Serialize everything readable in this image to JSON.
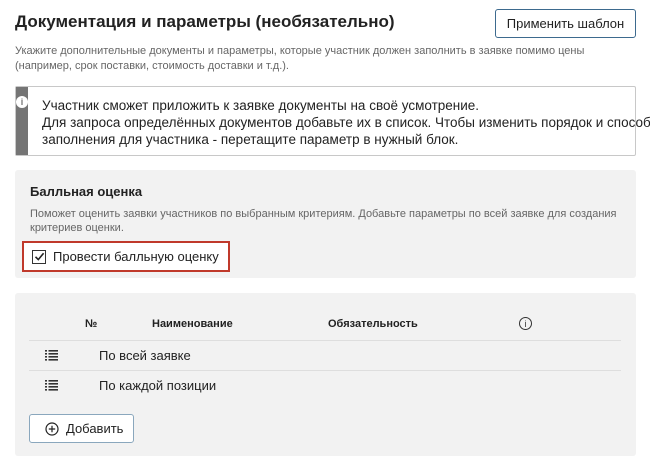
{
  "header": {
    "title": "Документация и параметры (необязательно)",
    "apply_template_label": "Применить шаблон",
    "subtitle": "Укажите дополнительные документы и параметры, которые участник должен заполнить в заявке помимо цены (например, срок поставки, стоимость доставки и т.д.)."
  },
  "info": {
    "lines": [
      "Участник сможет приложить к заявке документы на своё усмотрение.",
      "Для запроса определённых документов добавьте их в список. Чтобы изменить порядок и способ",
      "заполнения для участника - перетащите параметр в нужный блок."
    ]
  },
  "scoring": {
    "title": "Балльная оценка",
    "description": "Поможет оценить заявки участников по выбранным критериям. Добавьте параметры по всей заявке для создания критериев оценки.",
    "checkbox_label": "Провести балльную оценку",
    "checked": true
  },
  "table": {
    "columns": [
      "№",
      "Наименование",
      "Обязательность"
    ],
    "rows": [
      {
        "label": "По всей заявке"
      },
      {
        "label": "По каждой позиции"
      }
    ],
    "add_label": "Добавить"
  },
  "colors": {
    "accent_border": "#3d6a8e",
    "highlight": "#c0392b",
    "panel_bg": "#f2f2f2"
  }
}
